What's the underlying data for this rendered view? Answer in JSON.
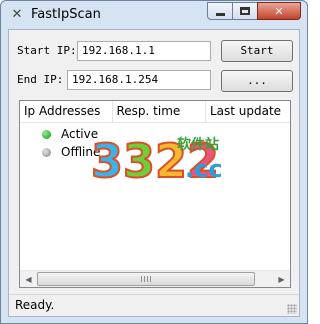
{
  "window": {
    "title": "FastIpScan",
    "icon": "app-icon",
    "controls": [
      "minimize-icon",
      "maximize-icon",
      "close-icon"
    ]
  },
  "scan": {
    "start_label": "Start IP:",
    "start_value": "192.168.1.1",
    "end_label": "End IP:",
    "end_value": "192.168.1.254",
    "start_button": "Start",
    "more_button": "..."
  },
  "list": {
    "columns": [
      "Ip Addresses",
      "Resp. time",
      "Last update"
    ],
    "rows": [
      {
        "status": "Active",
        "color": "#3dbb3d"
      },
      {
        "status": "Offline",
        "color": "#a8a8a8"
      }
    ]
  },
  "watermark": {
    "number": "3322",
    "suffix": ".cc",
    "tag": "软件站"
  },
  "status": {
    "text": "Ready."
  }
}
